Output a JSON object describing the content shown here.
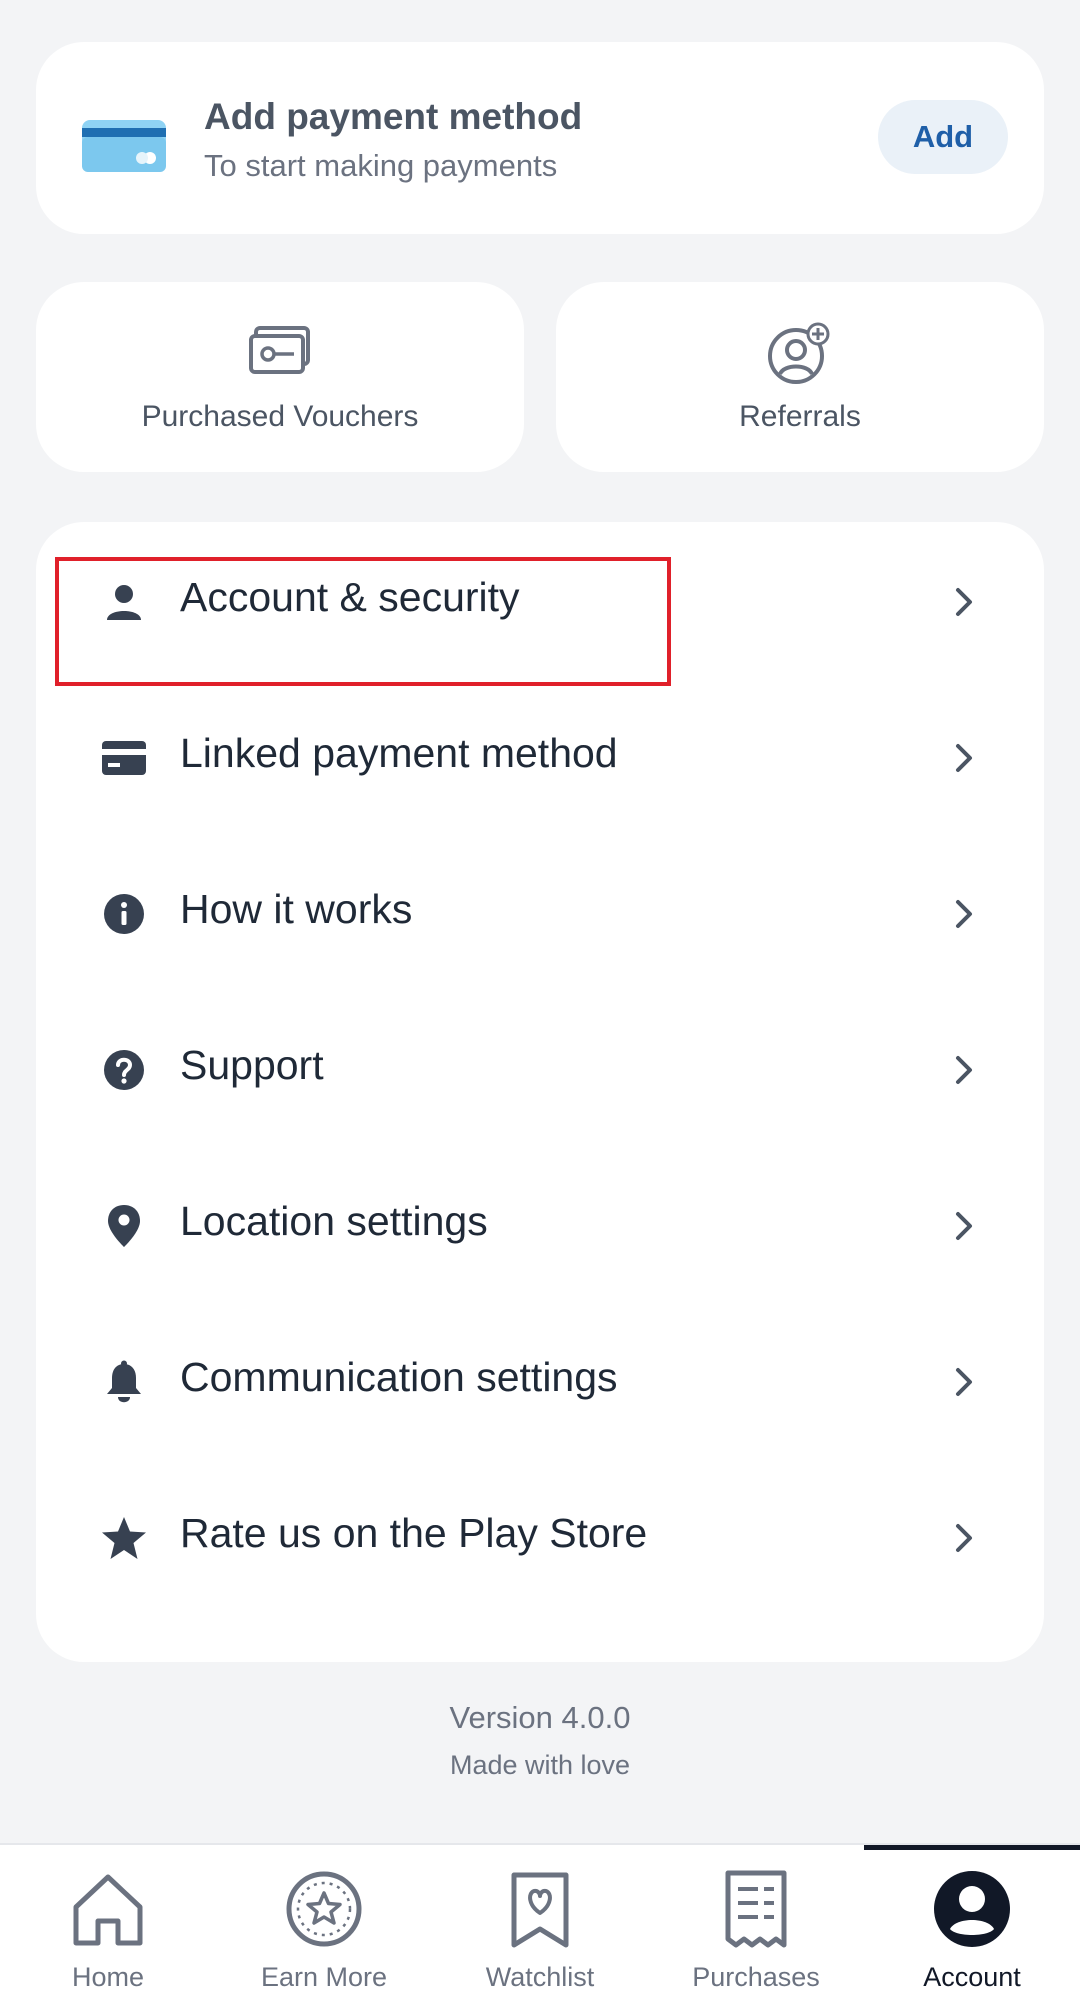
{
  "payment_card": {
    "title": "Add payment method",
    "subtitle": "To start making payments",
    "add_label": "Add",
    "icon": "credit-card-icon"
  },
  "tiles": [
    {
      "label": "Purchased Vouchers",
      "icon": "voucher-icon"
    },
    {
      "label": "Referrals",
      "icon": "referral-add-user-icon"
    }
  ],
  "menu": {
    "items": [
      {
        "label": "Account & security",
        "icon": "person-icon"
      },
      {
        "label": "Linked payment method",
        "icon": "card-icon"
      },
      {
        "label": "How it works",
        "icon": "info-icon"
      },
      {
        "label": "Support",
        "icon": "question-icon"
      },
      {
        "label": "Location settings",
        "icon": "location-pin-icon"
      },
      {
        "label": "Communication settings",
        "icon": "bell-icon"
      },
      {
        "label": "Rate us on the Play Store",
        "icon": "star-icon"
      }
    ]
  },
  "footer": {
    "version": "Version 4.0.0",
    "made_with": "Made with love"
  },
  "bottom_nav": {
    "active": "Account",
    "items": [
      {
        "label": "Home",
        "icon": "home-icon"
      },
      {
        "label": "Earn More",
        "icon": "earn-star-icon"
      },
      {
        "label": "Watchlist",
        "icon": "watchlist-heart-icon"
      },
      {
        "label": "Purchases",
        "icon": "receipt-icon"
      },
      {
        "label": "Account",
        "icon": "account-avatar-icon"
      }
    ]
  },
  "colors": {
    "background": "#f3f4f6",
    "card": "#ffffff",
    "accent": "#1f5fa8",
    "highlight": "#e0202a",
    "text": "#1f2937"
  }
}
